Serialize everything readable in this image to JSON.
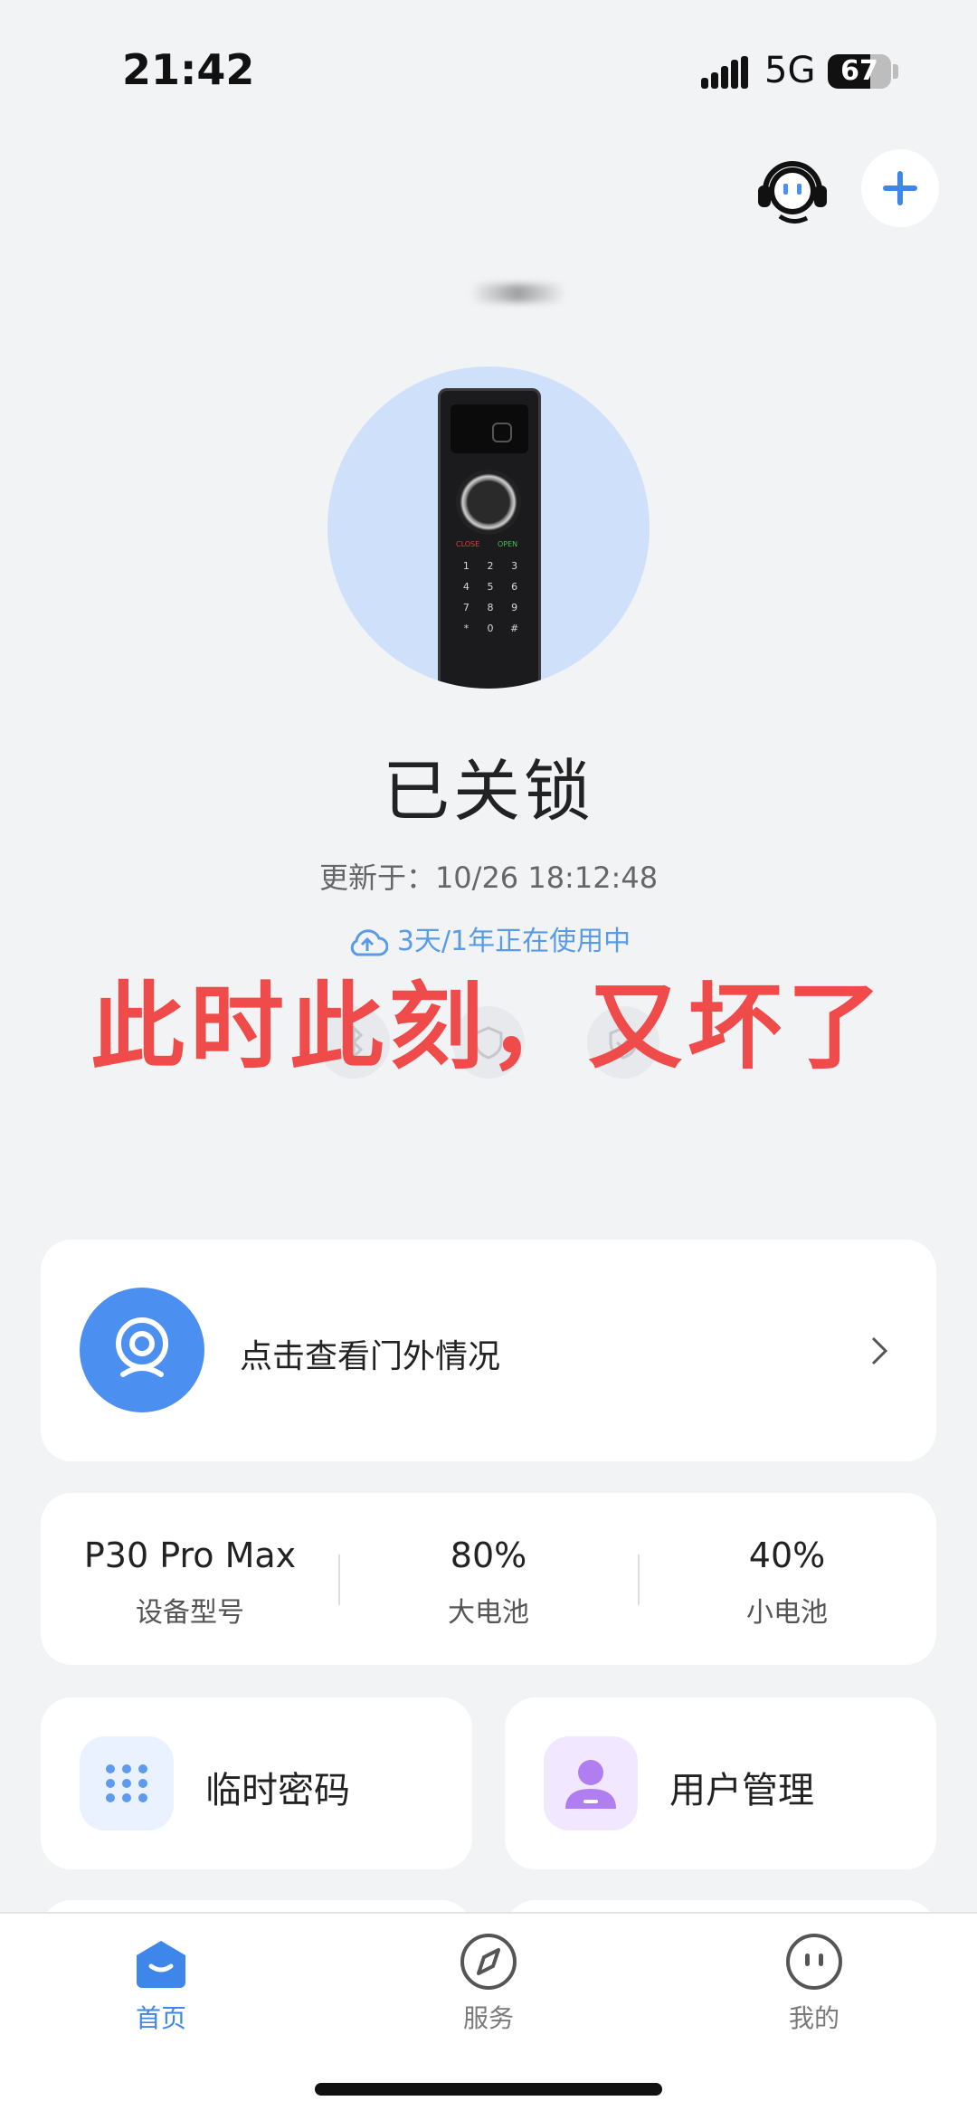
{
  "status_bar": {
    "time": "21:42",
    "network": "5G",
    "battery_level": 67,
    "battery_text": "67"
  },
  "lock": {
    "status": "已关锁",
    "updated": "更新于：10/26 18:12:48",
    "cloud_plan": "3天/1年正在使用中",
    "keypad_close": "CLOSE",
    "keypad_open": "OPEN",
    "keys": [
      "1",
      "2",
      "3",
      "4",
      "5",
      "6",
      "7",
      "8",
      "9",
      "*",
      "0",
      "#"
    ]
  },
  "overlay_caption": "此时此刻，又坏了",
  "feature_icons": [
    "bluetooth-icon",
    "shield-icon",
    "shield-check-icon"
  ],
  "camera_card": {
    "label": "点击查看门外情况"
  },
  "info": [
    {
      "value": "P30 Pro Max",
      "label": "设备型号"
    },
    {
      "value": "80%",
      "label": "大电池"
    },
    {
      "value": "40%",
      "label": "小电池"
    }
  ],
  "actions": [
    {
      "label": "临时密码",
      "icon": "keypad-icon",
      "color": "#eaf2ff"
    },
    {
      "label": "用户管理",
      "icon": "user-icon",
      "color": "#f1e8ff"
    }
  ],
  "nav": [
    {
      "label": "首页",
      "icon": "home-icon",
      "active": true
    },
    {
      "label": "服务",
      "icon": "compass-icon",
      "active": false
    },
    {
      "label": "我的",
      "icon": "profile-icon",
      "active": false
    }
  ],
  "colors": {
    "accent": "#3f86ea",
    "overlay": "#f04b4b",
    "inactive": "#7a7a7a"
  }
}
